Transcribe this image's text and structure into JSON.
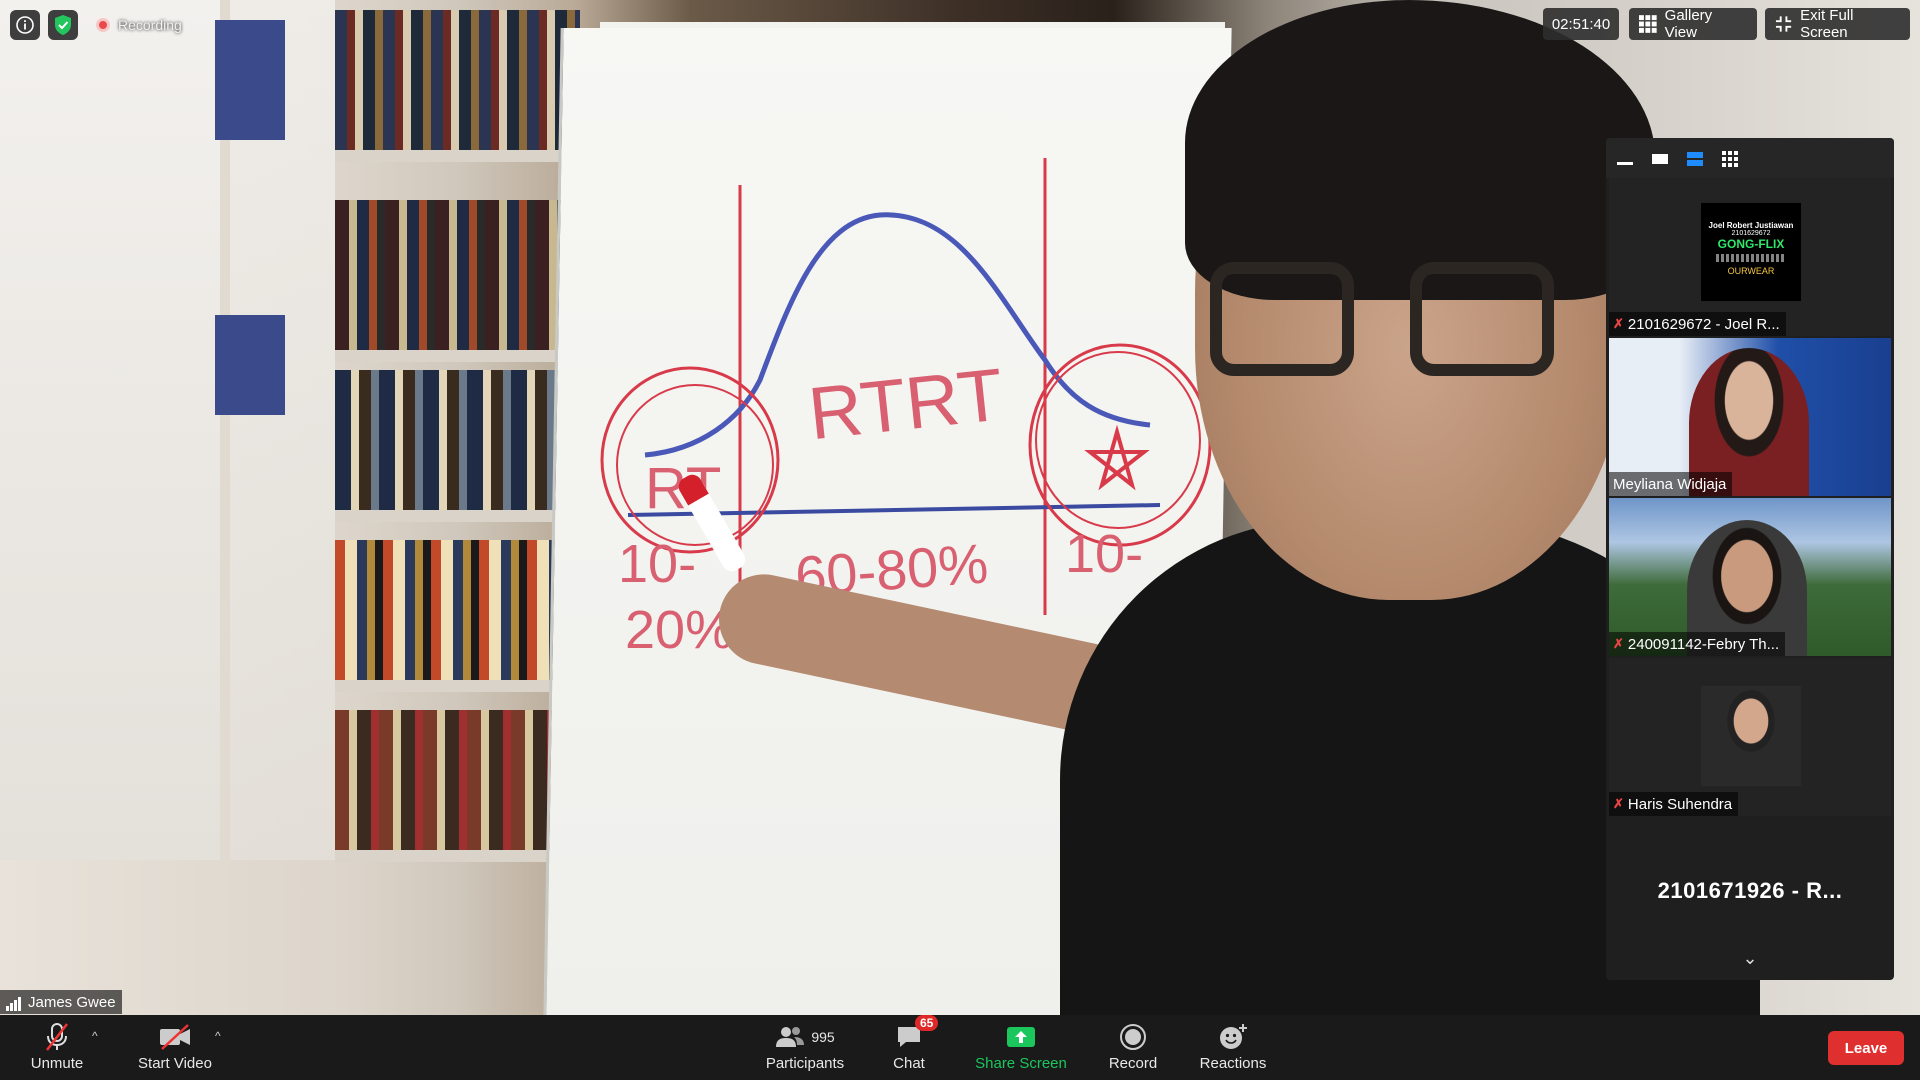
{
  "top_bar": {
    "recording_label": "Recording",
    "timer": "02:51:40",
    "gallery_view_label": "Gallery View",
    "exit_full_screen_label": "Exit Full Screen"
  },
  "main_video": {
    "speaker_name": "James Gwee",
    "whiteboard_text": [
      "RTRT",
      "RT",
      "10-",
      "20%",
      "60-80%",
      "10-"
    ]
  },
  "gallery": {
    "participants": [
      {
        "name": "2101629672 - Joel R...",
        "muted": true,
        "thumb_text": [
          "Joel Robert Justiawan",
          "2101629672",
          "GONG-FLIX",
          "OURWEAR"
        ]
      },
      {
        "name": "Meyliana Widjaja",
        "muted": false
      },
      {
        "name": "240091142-Febry Th...",
        "muted": true
      },
      {
        "name": "Haris Suhendra",
        "muted": true
      }
    ],
    "overflow_name": "2101671926 - R..."
  },
  "toolbar": {
    "unmute_label": "Unmute",
    "start_video_label": "Start Video",
    "participants_label": "Participants",
    "participants_count": "995",
    "chat_label": "Chat",
    "chat_badge": "65",
    "share_screen_label": "Share Screen",
    "record_label": "Record",
    "reactions_label": "Reactions",
    "leave_label": "Leave"
  },
  "colors": {
    "share_green": "#1bc65c",
    "leave_red": "#e02f2f",
    "badge_red": "#e02828",
    "marker_red": "#d83a4a",
    "marker_blue": "#4a58b8"
  },
  "icons": [
    "info-icon",
    "shield-icon",
    "record-icon",
    "grid-icon",
    "exit-fullscreen-icon",
    "mic-muted-icon",
    "video-off-icon",
    "participants-icon",
    "chat-icon",
    "share-screen-icon",
    "record-button-icon",
    "reactions-icon",
    "chevron-down-icon"
  ]
}
